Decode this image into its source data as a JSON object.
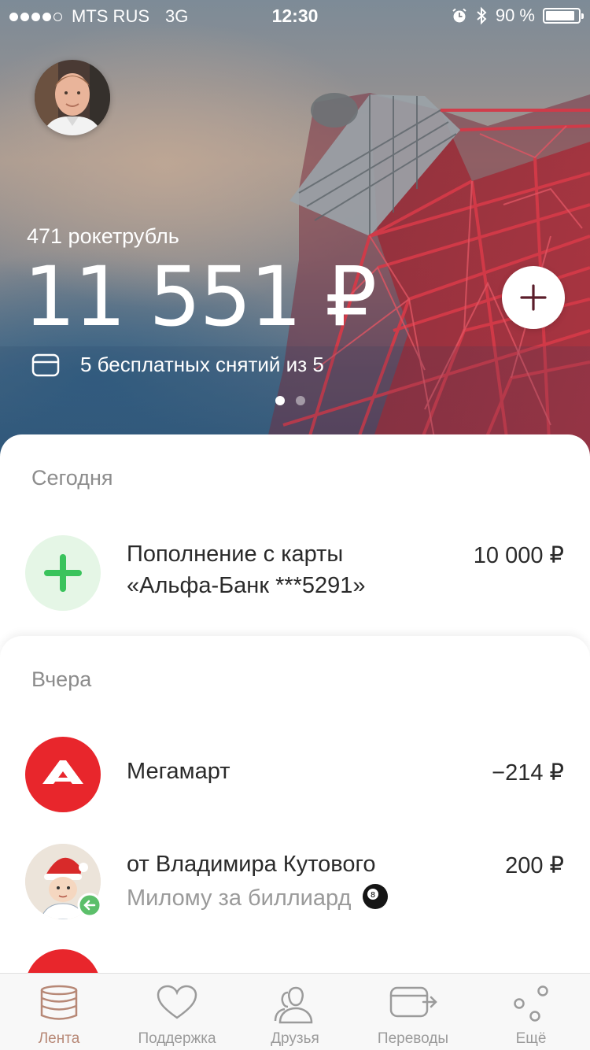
{
  "status_bar": {
    "carrier": "MTS RUS",
    "network": "3G",
    "time": "12:30",
    "battery": "90 %",
    "battery_level": 0.9
  },
  "account": {
    "rocket_rubles": "471 рокетрубль",
    "balance": "11 551 ₽",
    "free_withdrawals": "5 бесплатных снятий из 5",
    "pages": 2,
    "active_page": 0
  },
  "feed": {
    "today": {
      "title": "Сегодня",
      "items": [
        {
          "title_line1": "Пополнение с карты",
          "title_line2": "«Альфа-Банк ***5291»",
          "amount": "10 000 ₽",
          "icon": "plus-icon"
        }
      ]
    },
    "yesterday": {
      "title": "Вчера",
      "items": [
        {
          "title": "Мегамарт",
          "amount": "−214 ₽",
          "icon": "megamart-logo"
        },
        {
          "title": "от Владимира Кутового",
          "subtitle": "Милому за биллиард",
          "amount": "200 ₽",
          "icon": "contact-avatar"
        }
      ]
    }
  },
  "tabs": [
    {
      "label": "Лента",
      "icon": "feed-stack-icon",
      "active": true
    },
    {
      "label": "Поддержка",
      "icon": "heart-icon",
      "active": false
    },
    {
      "label": "Друзья",
      "icon": "friends-icon",
      "active": false
    },
    {
      "label": "Переводы",
      "icon": "transfer-card-icon",
      "active": false
    },
    {
      "label": "Ещё",
      "icon": "more-dots-icon",
      "active": false
    }
  ],
  "colors": {
    "accent": "#b78876",
    "megamart_red": "#e8262c",
    "income_green": "#3ac35c",
    "income_bg": "#e5f6e6",
    "add_button_icon": "#5b1d2a"
  }
}
